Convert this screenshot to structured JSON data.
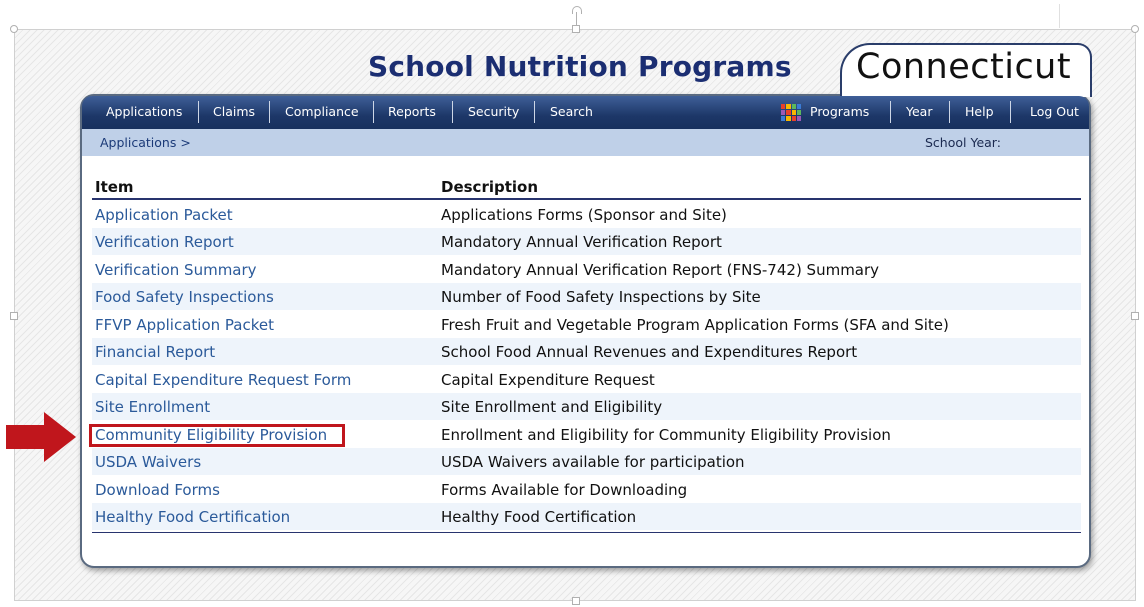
{
  "header": {
    "title": "School Nutrition Programs",
    "state": "Connecticut"
  },
  "nav": {
    "left": [
      "Applications",
      "Claims",
      "Compliance",
      "Reports",
      "Security",
      "Search"
    ],
    "right": [
      "Programs",
      "Year",
      "Help",
      "Log Out"
    ]
  },
  "breadcrumb": {
    "path": "Applications >",
    "school_year_label": "School Year:"
  },
  "table": {
    "headers": [
      "Item",
      "Description"
    ],
    "rows": [
      {
        "item": "Application Packet",
        "description": "Applications Forms (Sponsor and Site)"
      },
      {
        "item": "Verification Report",
        "description": "Mandatory Annual Verification Report"
      },
      {
        "item": "Verification Summary",
        "description": "Mandatory Annual Verification Report (FNS-742) Summary"
      },
      {
        "item": "Food Safety Inspections",
        "description": "Number of Food Safety Inspections by Site"
      },
      {
        "item": "FFVP Application Packet",
        "description": "Fresh Fruit and Vegetable Program Application Forms (SFA and Site)"
      },
      {
        "item": "Financial Report",
        "description": "School Food Annual Revenues and Expenditures Report"
      },
      {
        "item": "Capital Expenditure Request Form",
        "description": "Capital Expenditure Request"
      },
      {
        "item": "Site Enrollment",
        "description": "Site Enrollment and Eligibility"
      },
      {
        "item": "Community Eligibility Provision",
        "description": "Enrollment and Eligibility for Community Eligibility Provision"
      },
      {
        "item": "USDA Waivers",
        "description": "USDA Waivers available for participation"
      },
      {
        "item": "Download Forms",
        "description": "Forms Available for Downloading"
      },
      {
        "item": "Healthy Food Certification",
        "description": "Healthy Food Certification"
      }
    ]
  },
  "colors": {
    "title": "#1b2e72",
    "nav_bar": "#1d3768",
    "breadcrumb_bar": "#bfd0e8",
    "link": "#2b5a9a",
    "highlight": "#c0161c"
  },
  "icons": {
    "programs": "programs-grid-icon",
    "callout": "red-arrow-icon"
  }
}
